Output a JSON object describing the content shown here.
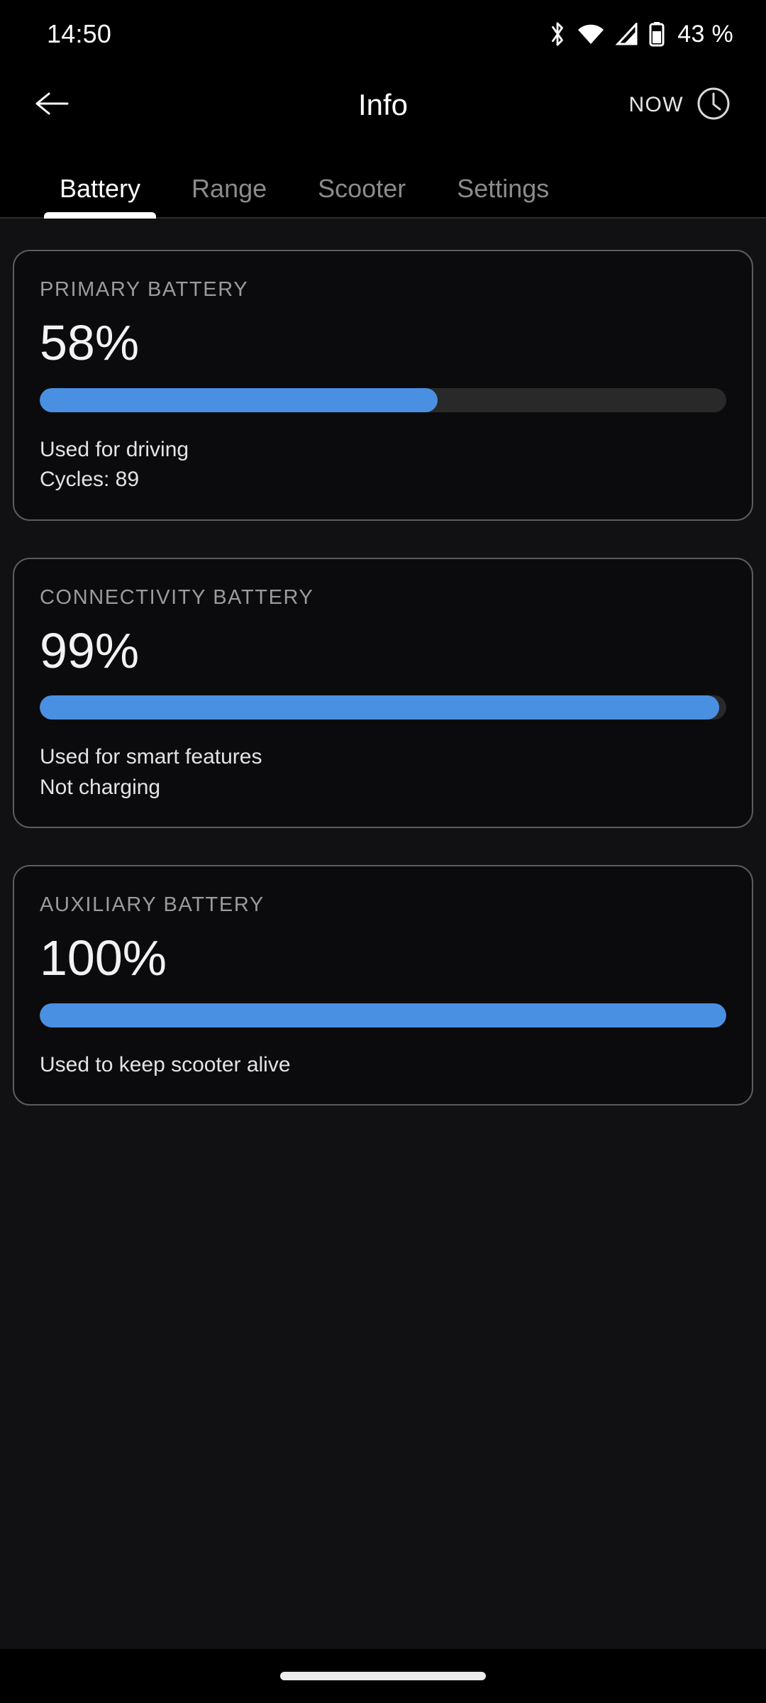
{
  "status_bar": {
    "time": "14:50",
    "battery_percent": "43 %",
    "icons": [
      "bluetooth-icon",
      "wifi-icon",
      "cellular-signal-icon",
      "battery-icon"
    ]
  },
  "app_bar": {
    "back_icon": "arrow-left-icon",
    "title": "Info",
    "now_label": "NOW",
    "clock_icon": "clock-icon"
  },
  "tabs": [
    {
      "label": "Battery",
      "active": true
    },
    {
      "label": "Range",
      "active": false
    },
    {
      "label": "Scooter",
      "active": false
    },
    {
      "label": "Settings",
      "active": false
    }
  ],
  "colors": {
    "accent": "#4a90e2",
    "track": "#292929",
    "card_bg": "#0b0b0d",
    "card_border": "#5c5c60",
    "page_bg": "#111113",
    "label": "#9b9b9e"
  },
  "battery_cards": [
    {
      "label": "PRIMARY BATTERY",
      "value": "58%",
      "percent": 58,
      "note_1": "Used for driving",
      "note_2": "Cycles: 89"
    },
    {
      "label": "CONNECTIVITY BATTERY",
      "value": "99%",
      "percent": 99,
      "note_1": "Used for smart features",
      "note_2": "Not charging"
    },
    {
      "label": "AUXILIARY BATTERY",
      "value": "100%",
      "percent": 100,
      "note_1": "Used to keep scooter alive",
      "note_2": ""
    }
  ],
  "nav_bar": {
    "home_indicator": "home-gesture-pill"
  }
}
